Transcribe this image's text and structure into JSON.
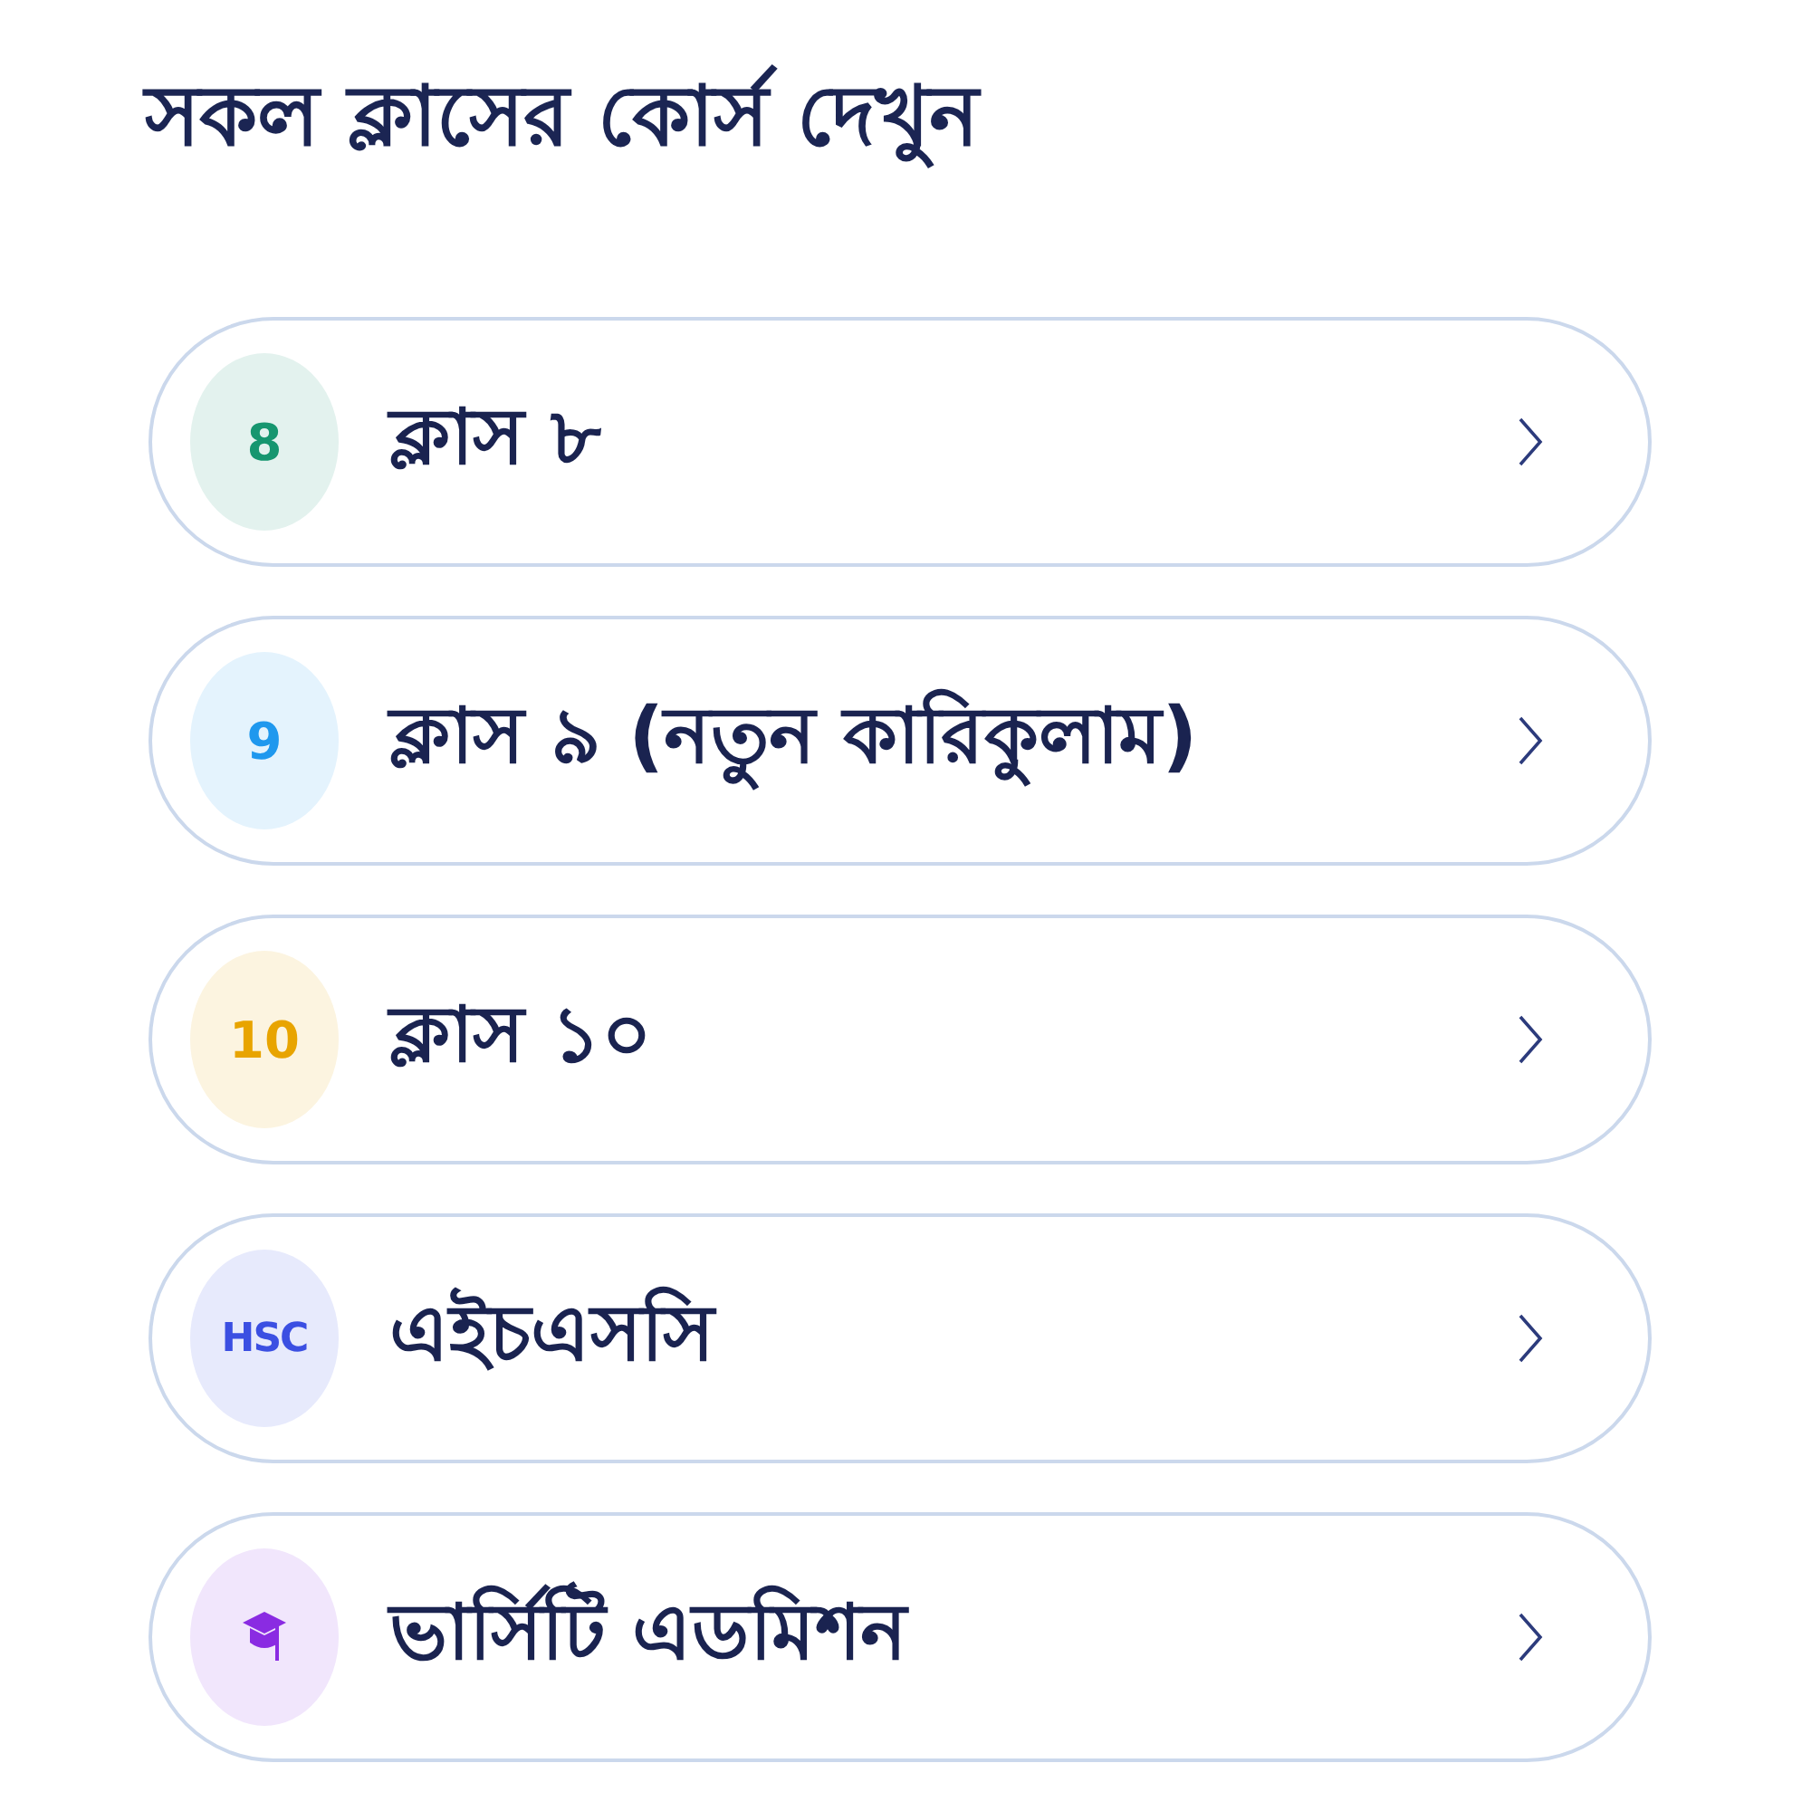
{
  "heading": "সকল ক্লাসের কোর্স দেখুন",
  "items": [
    {
      "kind": "number",
      "badge": "8",
      "color": "#16966f",
      "label": "ক্লাস ৮"
    },
    {
      "kind": "number",
      "badge": "9",
      "color": "#1f98ee",
      "label": "ক্লাস ৯ (নতুন কারিকুলাম)"
    },
    {
      "kind": "number",
      "badge": "10",
      "color": "#e8a400",
      "label": "ক্লাস ১০"
    },
    {
      "kind": "number",
      "badge": "HSC",
      "color": "#3b4fe2",
      "label": "এইচএসসি"
    },
    {
      "kind": "icon",
      "color": "#8a2be2",
      "label": "ভার্সিটি এডমিশন"
    }
  ]
}
